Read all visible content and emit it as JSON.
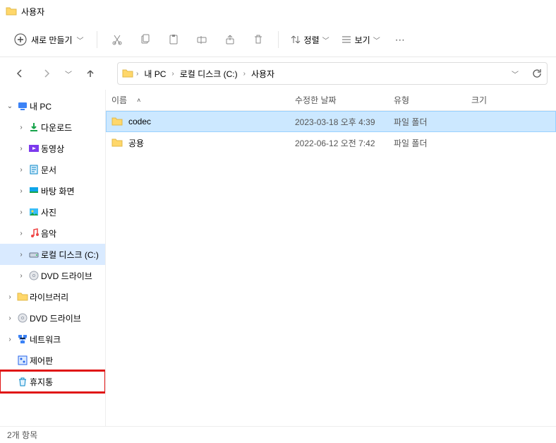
{
  "window": {
    "title": "사용자"
  },
  "toolbar": {
    "new_label": "새로 만들기",
    "sort_label": "정렬",
    "view_label": "보기"
  },
  "breadcrumb": [
    {
      "label": "내 PC"
    },
    {
      "label": "로컬 디스크 (C:)"
    },
    {
      "label": "사용자"
    }
  ],
  "columns": {
    "name": "이름",
    "date": "수정한 날짜",
    "type": "유형",
    "size": "크기",
    "sort": "name_asc"
  },
  "tree": [
    {
      "id": "this-pc",
      "label": "내 PC",
      "icon": "pc",
      "expanded": true,
      "depth": 0
    },
    {
      "id": "downloads",
      "label": "다운로드",
      "icon": "download",
      "depth": 1
    },
    {
      "id": "videos",
      "label": "동영상",
      "icon": "video",
      "depth": 1
    },
    {
      "id": "documents",
      "label": "문서",
      "icon": "doc",
      "depth": 1
    },
    {
      "id": "desktop",
      "label": "바탕 화면",
      "icon": "desktop",
      "depth": 1
    },
    {
      "id": "pictures",
      "label": "사진",
      "icon": "picture",
      "depth": 1
    },
    {
      "id": "music",
      "label": "음악",
      "icon": "music",
      "depth": 1
    },
    {
      "id": "local-disk",
      "label": "로컬 디스크 (C:)",
      "icon": "drive",
      "depth": 1,
      "selected": true
    },
    {
      "id": "dvd1",
      "label": "DVD 드라이브",
      "icon": "dvd",
      "depth": 1
    },
    {
      "id": "libraries",
      "label": "라이브러리",
      "icon": "folder",
      "depth": 0
    },
    {
      "id": "dvd2",
      "label": "DVD 드라이브",
      "icon": "dvd",
      "depth": 0
    },
    {
      "id": "network",
      "label": "네트워크",
      "icon": "network",
      "depth": 0
    },
    {
      "id": "control-panel",
      "label": "제어판",
      "icon": "control",
      "depth": 0,
      "noexp": true
    },
    {
      "id": "recycle",
      "label": "휴지통",
      "icon": "recycle",
      "depth": 0,
      "noexp": true,
      "highlighted": true
    }
  ],
  "files": [
    {
      "name": "codec",
      "date": "2023-03-18 오후 4:39",
      "type": "파일 폴더",
      "size": "",
      "selected": true
    },
    {
      "name": "공용",
      "date": "2022-06-12 오전 7:42",
      "type": "파일 폴더",
      "size": ""
    }
  ],
  "status": {
    "count_label": "2개 항목"
  }
}
